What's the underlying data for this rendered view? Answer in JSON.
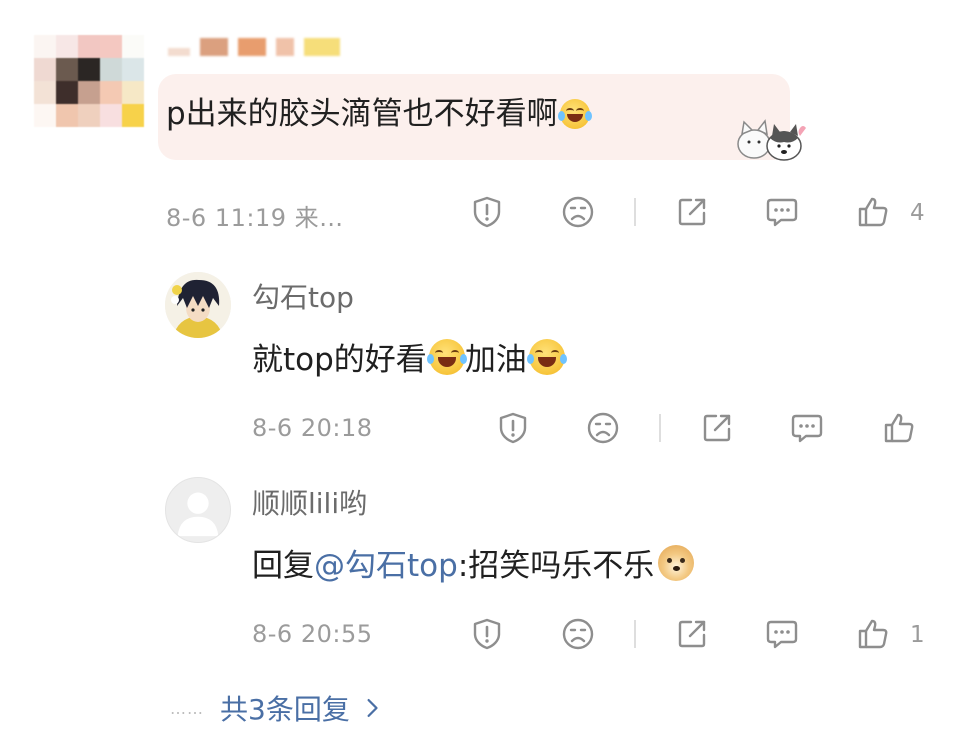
{
  "comment": {
    "text": "p出来的胶头滴管也不好看啊",
    "emoji": "laugh-cry-emoji",
    "meta": "8-6 11:19 来…",
    "like_count": "4"
  },
  "replies": [
    {
      "username": "勾石top",
      "text": "就top的好看",
      "text_mid": "加油",
      "meta": "8-6 20:18",
      "like_count": ""
    },
    {
      "username": "顺顺lili哟",
      "prefix": "回复",
      "mention": "@勾石top",
      "text": ":招笑吗乐不乐",
      "meta": "8-6 20:55",
      "like_count": "1"
    }
  ],
  "more_replies": {
    "dots": "……",
    "label": "共3条回复"
  },
  "colors": {
    "bubble_bg": "#fcf0ed",
    "link": "#4a6fa5",
    "meta_gray": "#9b9b9b"
  }
}
